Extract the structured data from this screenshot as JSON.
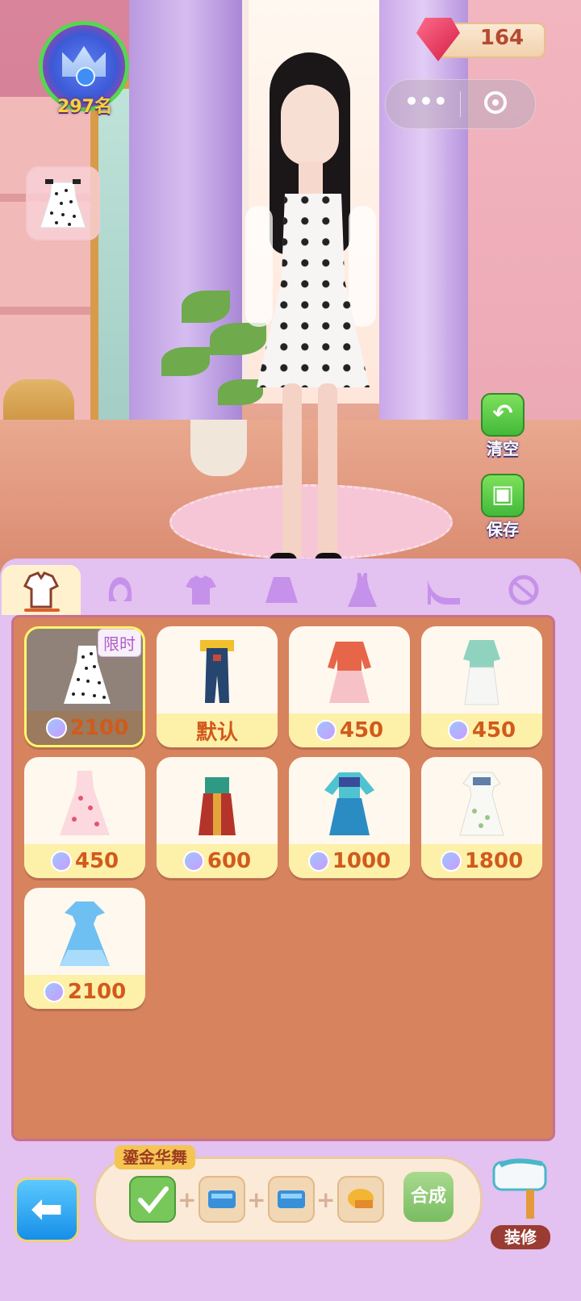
{
  "hud": {
    "rank_label": "297名",
    "gems": "164"
  },
  "side_buttons": {
    "clear_label": "清空",
    "save_label": "保存"
  },
  "tabs": [
    {
      "name": "outfit",
      "icon": "clothing-icon",
      "active": true
    },
    {
      "name": "hair",
      "icon": "hair-icon"
    },
    {
      "name": "top",
      "icon": "shirt-icon"
    },
    {
      "name": "skirt",
      "icon": "skirt-icon"
    },
    {
      "name": "dress",
      "icon": "dress-icon"
    },
    {
      "name": "shoes",
      "icon": "high-heel-icon"
    },
    {
      "name": "accessory",
      "icon": "accessory-icon"
    }
  ],
  "items": [
    {
      "price": "2100",
      "badge": "限时",
      "selected": true,
      "garment": "polka-dot-dress"
    },
    {
      "price": "默认",
      "garment": "denim-overalls"
    },
    {
      "price": "450",
      "garment": "red-pink-outfit"
    },
    {
      "price": "450",
      "garment": "mint-blouse-white-skirt"
    },
    {
      "price": "450",
      "garment": "pink-floral-gown"
    },
    {
      "price": "600",
      "garment": "red-green-hanfu"
    },
    {
      "price": "1000",
      "garment": "teal-blue-hanfu"
    },
    {
      "price": "1800",
      "garment": "white-embroidered-dress"
    },
    {
      "price": "2100",
      "garment": "blue-ice-dress"
    }
  ],
  "recipe": {
    "title": "鎏金华舞",
    "craft_label": "合成"
  },
  "decorate_label": "装修",
  "colors": {
    "panel": "#e3c1f0",
    "grid": "#d7835e",
    "price_text": "#d15a1c",
    "green_button": "#43b93a"
  }
}
